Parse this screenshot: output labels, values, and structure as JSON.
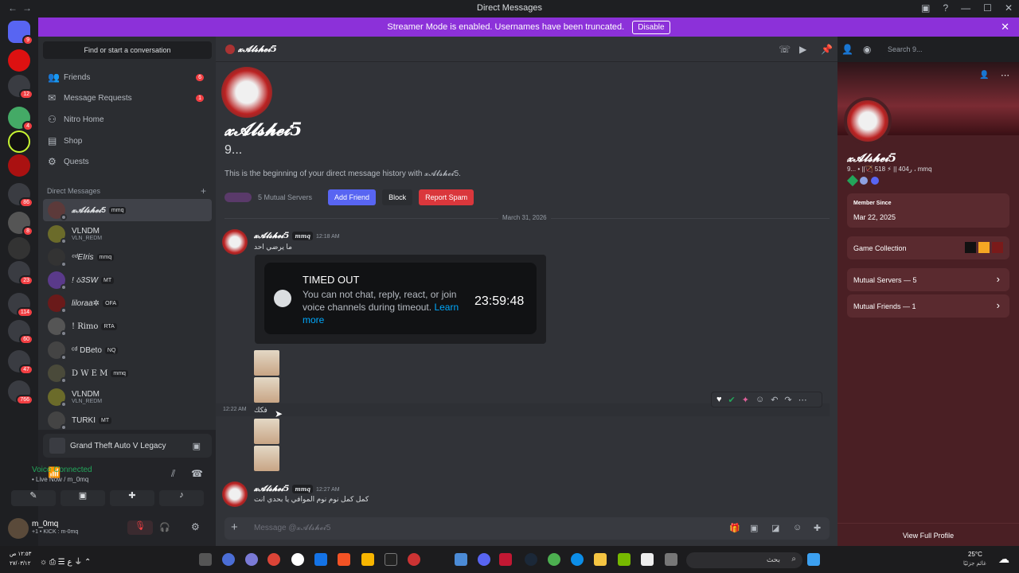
{
  "window": {
    "title": "Direct Messages"
  },
  "banner": {
    "text": "Streamer Mode is enabled. Usernames have been truncated.",
    "disable_label": "Disable"
  },
  "sidebar": {
    "search_placeholder": "Find or start a conversation",
    "nav": [
      {
        "label": "Friends",
        "count": "6"
      },
      {
        "label": "Message Requests",
        "count": "1"
      },
      {
        "label": "Nitro Home",
        "count": ""
      },
      {
        "label": "Shop",
        "count": ""
      },
      {
        "label": "Quests",
        "count": ""
      }
    ],
    "dm_header": "Direct Messages",
    "dms": [
      {
        "name": "𝔁𝓐𝓵𝓼𝓱𝓮𝓲5",
        "tag": "mmq",
        "sub": ""
      },
      {
        "name": "VLNDM",
        "tag": "",
        "sub": "VLN_REDM"
      },
      {
        "name": "ᶜᵈEIris",
        "tag": "mmq",
        "sub": ""
      },
      {
        "name": "! ઠ3SW",
        "tag": "MT",
        "sub": ""
      },
      {
        "name": "liloraa✲",
        "tag": "OFA",
        "sub": ""
      },
      {
        "name": "! Rimo",
        "tag": "RTA",
        "sub": ""
      },
      {
        "name": "ᶜᵈ DBeto",
        "tag": "NQ",
        "sub": ""
      },
      {
        "name": "D W E M",
        "tag": "mmq",
        "sub": ""
      },
      {
        "name": "VLNDM",
        "tag": "",
        "sub": "VLN_REDM"
      },
      {
        "name": "TURKI",
        "tag": "MT",
        "sub": ""
      }
    ],
    "game": "Grand Theft Auto V Legacy",
    "voice_status": "Voice Connected",
    "voice_sub": "• Live Now / m_0mq",
    "user_name": "m_0mq",
    "user_sub": "+1 • KICK : m-0mq"
  },
  "chat": {
    "header_name": "𝔁𝓐𝓵𝓼𝓱𝓮𝓲5",
    "search_placeholder": "Search 9...",
    "intro_name": "𝔁𝓐𝓵𝓼𝓱𝓮𝓲5",
    "intro_sub": "9...",
    "intro_desc": "This is the beginning of your direct message history with 𝔁𝓐𝓵𝓼𝓱𝓮𝓲5.",
    "mutual_servers": "5 Mutual Servers",
    "add_friend": "Add Friend",
    "block": "Block",
    "report": "Report Spam",
    "date_divider": "March 31, 2026",
    "msg1": {
      "name": "𝔁𝓐𝓵𝓼𝓱𝓮𝓲5",
      "tag": "mmq",
      "time": "12:18 AM",
      "text": "ما يرضي احد"
    },
    "timeout": {
      "title": "TIMED OUT",
      "desc": "You can not chat, reply, react, or join voice channels during timeout.",
      "link": "Learn more",
      "countdown": "23:59:48"
    },
    "msg2": {
      "time": "12:22 AM",
      "text": "فكك"
    },
    "msg3": {
      "name": "𝔁𝓐𝓵𝓼𝓱𝓮𝓲5",
      "tag": "mmq",
      "time": "12:27 AM",
      "text": "كمل كمل نوم نوم الموافي يا بحدي انت"
    },
    "composer_placeholder": "Message @𝔁𝓐𝓵𝓼𝓱𝓮𝓲5"
  },
  "profile": {
    "name": "𝔁𝓐𝓵𝓼𝓱𝓮𝓲5",
    "status": "9... • ||🏹 518 ⚡ || ر404 ، mmq",
    "member_since_label": "Member Since",
    "member_since": "Mar 22, 2025",
    "game_collection": "Game Collection",
    "mutual_servers": "Mutual Servers — 5",
    "mutual_friends": "Mutual Friends — 1",
    "view_full": "View Full Profile"
  },
  "taskbar": {
    "time": "١٢:٥٣ ص",
    "date": "٢٧/٠٣/١٢",
    "weather_temp": "25°C",
    "weather_desc": "غائم جزئيًا",
    "search": "بحث"
  },
  "server_badges": [
    "9",
    "12",
    "4",
    "86",
    "8",
    "23",
    "114",
    "60",
    "47",
    "766"
  ],
  "accent": "#5865f2",
  "banner_color": "#8c31d9"
}
